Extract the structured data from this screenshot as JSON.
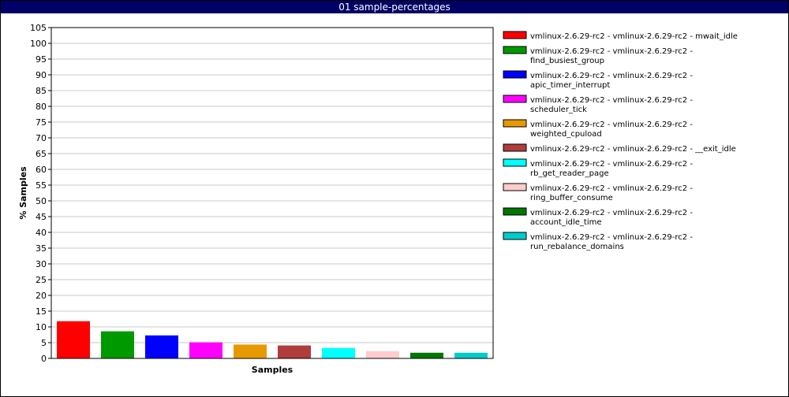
{
  "chart_data": {
    "type": "bar",
    "title": "01 sample-percentages",
    "xlabel": "Samples",
    "ylabel": "% Samples",
    "ylim": [
      0,
      105
    ],
    "yticks": [
      0,
      5,
      10,
      15,
      20,
      25,
      30,
      35,
      40,
      45,
      50,
      55,
      60,
      65,
      70,
      75,
      80,
      85,
      90,
      95,
      100,
      105
    ],
    "grid": true,
    "legend_position": "right",
    "series": [
      {
        "name": "vmlinux-2.6.29-rc2 - vmlinux-2.6.29-rc2 - mwait_idle",
        "value": 11.8,
        "color": "#ff0000"
      },
      {
        "name": "vmlinux-2.6.29-rc2 - vmlinux-2.6.29-rc2 - find_busiest_group",
        "value": 8.6,
        "color": "#009900"
      },
      {
        "name": "vmlinux-2.6.29-rc2 - vmlinux-2.6.29-rc2 - apic_timer_interrupt",
        "value": 7.3,
        "color": "#0000ff"
      },
      {
        "name": "vmlinux-2.6.29-rc2 - vmlinux-2.6.29-rc2 - scheduler_tick",
        "value": 5.1,
        "color": "#ff00ff"
      },
      {
        "name": "vmlinux-2.6.29-rc2 - vmlinux-2.6.29-rc2 - weighted_cpuload",
        "value": 4.4,
        "color": "#e69900"
      },
      {
        "name": "vmlinux-2.6.29-rc2 - vmlinux-2.6.29-rc2 - __exit_idle",
        "value": 4.1,
        "color": "#b03c3c"
      },
      {
        "name": "vmlinux-2.6.29-rc2 - vmlinux-2.6.29-rc2 - rb_get_reader_page",
        "value": 3.3,
        "color": "#00ffff"
      },
      {
        "name": "vmlinux-2.6.29-rc2 - vmlinux-2.6.29-rc2 - ring_buffer_consume",
        "value": 2.3,
        "color": "#ffcccc"
      },
      {
        "name": "vmlinux-2.6.29-rc2 - vmlinux-2.6.29-rc2 - account_idle_time",
        "value": 1.8,
        "color": "#007700"
      },
      {
        "name": "vmlinux-2.6.29-rc2 - vmlinux-2.6.29-rc2 - run_rebalance_domains",
        "value": 1.8,
        "color": "#00cccc"
      }
    ]
  }
}
